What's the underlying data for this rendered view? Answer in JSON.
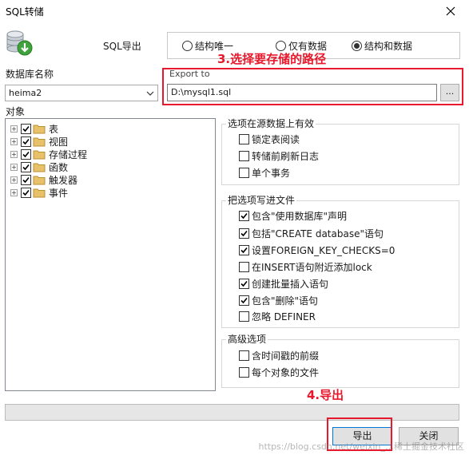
{
  "window": {
    "title": "SQL转储"
  },
  "header": {
    "sql_label": "SQL导出",
    "modes": [
      {
        "label": "结构唯一",
        "selected": false
      },
      {
        "label": "仅有数据",
        "selected": false
      },
      {
        "label": "结构和数据",
        "selected": true
      }
    ]
  },
  "annotations": {
    "step3": "3.选择要存储的路径",
    "step4": "4.导出"
  },
  "database": {
    "label": "数据库名称",
    "value": "heima2"
  },
  "export": {
    "label": "Export to",
    "path": "D:\\mysql1.sql",
    "browse_label": "..."
  },
  "objects": {
    "label": "对象",
    "items": [
      {
        "label": "表",
        "checked": true
      },
      {
        "label": "视图",
        "checked": true
      },
      {
        "label": "存储过程",
        "checked": true
      },
      {
        "label": "函数",
        "checked": true
      },
      {
        "label": "触发器",
        "checked": true
      },
      {
        "label": "事件",
        "checked": true
      }
    ]
  },
  "source_options": {
    "title": "选项在源数据上有效",
    "items": [
      {
        "label": "锁定表阅读",
        "checked": false
      },
      {
        "label": "转储前刷新日志",
        "checked": false
      },
      {
        "label": "单个事务",
        "checked": false
      }
    ]
  },
  "write_options": {
    "title": "把选项写进文件",
    "items": [
      {
        "label": "包含\"使用数据库\"声明",
        "checked": true
      },
      {
        "label": "包括\"CREATE database\"语句",
        "checked": true
      },
      {
        "label": "设置FOREIGN_KEY_CHECKS=0",
        "checked": true
      },
      {
        "label": "在INSERT语句附近添加lock",
        "checked": false
      },
      {
        "label": "创建批量插入语句",
        "checked": true
      },
      {
        "label": "包含\"删除\"语句",
        "checked": true
      },
      {
        "label": "忽略 DEFINER",
        "checked": false
      }
    ]
  },
  "advanced_options": {
    "title": "高级选项",
    "items": [
      {
        "label": "含时间戳的前缀",
        "checked": false
      },
      {
        "label": "每个对象的文件",
        "checked": false
      }
    ]
  },
  "buttons": {
    "export": "导出",
    "close": "关闭"
  },
  "watermark": "https://blog.csdn.net/weixin_…稀土掘金技术社区",
  "colors": {
    "annotation": "#e8192c",
    "folder": "#e8c26a"
  }
}
